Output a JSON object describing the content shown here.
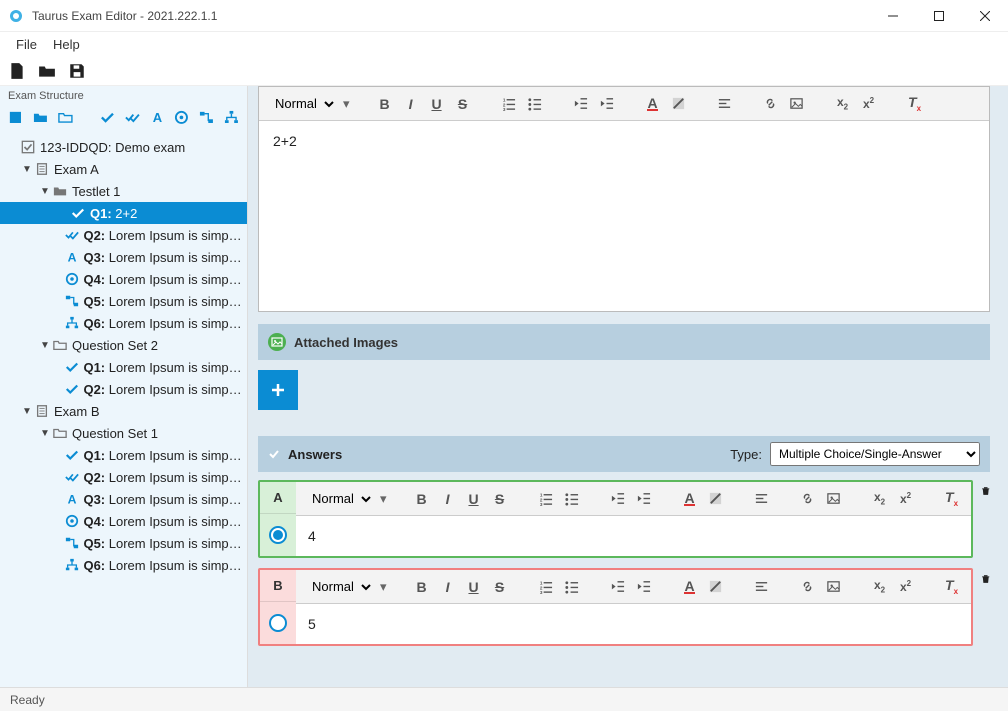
{
  "window": {
    "title": "Taurus Exam Editor - 2021.222.1.1"
  },
  "menubar": [
    "File",
    "Help"
  ],
  "sidebar": {
    "header": "Exam Structure",
    "root": "123-IDDQD: Demo exam",
    "exams": [
      {
        "name": "Exam A",
        "sets": [
          {
            "name": "Testlet 1",
            "icon": "folder-solid",
            "questions": [
              {
                "num": "Q1:",
                "text": "2+2",
                "icon": "check",
                "selected": true
              },
              {
                "num": "Q2:",
                "text": "Lorem Ipsum is simply du",
                "icon": "double-check"
              },
              {
                "num": "Q3:",
                "text": "Lorem Ipsum is simply du",
                "icon": "letter-a"
              },
              {
                "num": "Q4:",
                "text": "Lorem Ipsum is simply du",
                "icon": "target"
              },
              {
                "num": "Q5:",
                "text": "Lorem Ipsum is simply du",
                "icon": "drag"
              },
              {
                "num": "Q6:",
                "text": "Lorem Ipsum is simply du",
                "icon": "tree"
              }
            ]
          },
          {
            "name": "Question Set 2",
            "icon": "folder-outline",
            "questions": [
              {
                "num": "Q1:",
                "text": "Lorem Ipsum is simply du",
                "icon": "check"
              },
              {
                "num": "Q2:",
                "text": "Lorem Ipsum is simply du",
                "icon": "check"
              }
            ]
          }
        ]
      },
      {
        "name": "Exam B",
        "sets": [
          {
            "name": "Question Set 1",
            "icon": "folder-outline",
            "questions": [
              {
                "num": "Q1:",
                "text": "Lorem Ipsum is simply du",
                "icon": "check"
              },
              {
                "num": "Q2:",
                "text": "Lorem Ipsum is simply du",
                "icon": "double-check"
              },
              {
                "num": "Q3:",
                "text": "Lorem Ipsum is simply du",
                "icon": "letter-a"
              },
              {
                "num": "Q4:",
                "text": "Lorem Ipsum is simply du",
                "icon": "target"
              },
              {
                "num": "Q5:",
                "text": "Lorem Ipsum is simply du",
                "icon": "drag"
              },
              {
                "num": "Q6:",
                "text": "Lorem Ipsum is simply du",
                "icon": "tree"
              }
            ]
          }
        ]
      }
    ]
  },
  "editor": {
    "format": "Normal",
    "body": "2+2",
    "attached_header": "Attached Images",
    "answers_header": "Answers",
    "type_label": "Type:",
    "type_value": "Multiple Choice/Single-Answer",
    "answers": [
      {
        "letter": "A",
        "text": "4",
        "correct": true
      },
      {
        "letter": "B",
        "text": "5",
        "correct": false
      }
    ]
  },
  "status": "Ready"
}
